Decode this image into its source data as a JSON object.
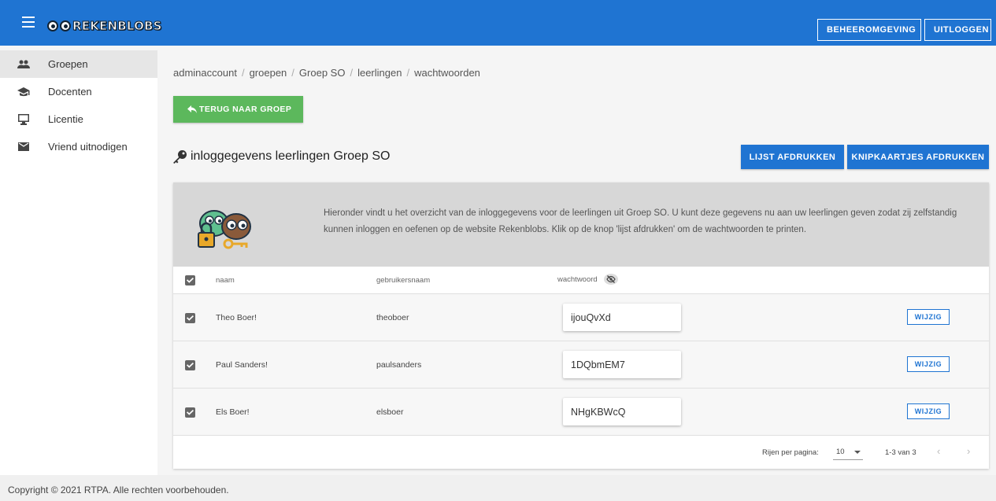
{
  "header": {
    "logo_text": "REKENBLOBS",
    "menu_icon": "menu-icon",
    "buttons": {
      "beheer": "BEHEEROMGEVING",
      "uitloggen": "UITLOGGEN"
    },
    "color": "#1f74d2"
  },
  "sidebar": {
    "items": [
      {
        "label": "Groepen",
        "icon": "group-icon",
        "active": true
      },
      {
        "label": "Docenten",
        "icon": "school-icon",
        "active": false
      },
      {
        "label": "Licentie",
        "icon": "monitor-icon",
        "active": false
      },
      {
        "label": "Vriend uitnodigen",
        "icon": "mail-icon",
        "active": false
      }
    ]
  },
  "breadcrumb": [
    "adminaccount",
    "groepen",
    "Groep SO",
    "leerlingen",
    "wachtwoorden"
  ],
  "back_button": "TERUG NAAR GROEP",
  "page_title": "inloggegevens leerlingen Groep SO",
  "actions": {
    "lijst": "LIJST AFDRUKKEN",
    "knip": "KNIPKAARTJES AFDRUKKEN"
  },
  "info_text": "Hieronder vindt u het overzicht van de inloggegevens voor de leerlingen uit Groep SO. U kunt deze gegevens nu aan uw leerlingen geven zodat zij zelfstandig kunnen inloggen en oefenen op de website Rekenblobs. Klik op de knop 'lijst afdrukken' om de wachtwoorden te printen.",
  "table": {
    "headers": {
      "naam": "naam",
      "gebruikersnaam": "gebruikersnaam",
      "wachtwoord": "wachtwoord"
    },
    "rows": [
      {
        "naam": "Theo Boer!",
        "gebruikersnaam": "theoboer",
        "wachtwoord": "ijouQvXd",
        "action": "WIJZIG"
      },
      {
        "naam": "Paul Sanders!",
        "gebruikersnaam": "paulsanders",
        "wachtwoord": "1DQbmEM7",
        "action": "WIJZIG"
      },
      {
        "naam": "Els Boer!",
        "gebruikersnaam": "elsboer",
        "wachtwoord": "NHgKBWcQ",
        "action": "WIJZIG"
      }
    ]
  },
  "pager": {
    "label": "Rijen per pagina:",
    "per_page": "10",
    "range": "1-3 van 3"
  },
  "footer": "Copyright © 2021 RTPA. Alle rechten voorbehouden."
}
